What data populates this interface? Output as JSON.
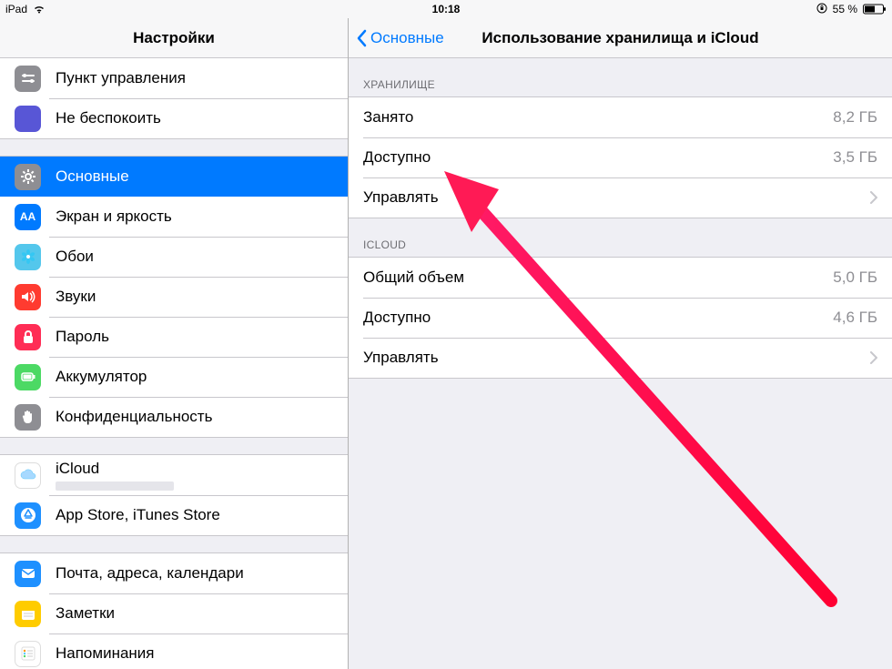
{
  "status": {
    "carrier": "iPad",
    "time": "10:18",
    "battery_pct": "55 %"
  },
  "sidebar": {
    "title": "Настройки",
    "groups": [
      {
        "rows": [
          {
            "id": "control-center",
            "label": "Пункт управления",
            "icon": "switches",
            "bg": "#8e8e93"
          },
          {
            "id": "dnd",
            "label": "Не беспокоить",
            "icon": "moon",
            "bg": "#5856d6"
          }
        ]
      },
      {
        "rows": [
          {
            "id": "general",
            "label": "Основные",
            "icon": "gear",
            "bg": "#8e8e93",
            "selected": true
          },
          {
            "id": "display",
            "label": "Экран и яркость",
            "icon": "AA",
            "bg": "#007aff",
            "text_icon": "AA"
          },
          {
            "id": "wallpaper",
            "label": "Обои",
            "icon": "flower",
            "bg": "#54c7ec"
          },
          {
            "id": "sounds",
            "label": "Звуки",
            "icon": "speaker",
            "bg": "#ff3b30"
          },
          {
            "id": "passcode",
            "label": "Пароль",
            "icon": "lock",
            "bg": "#ff2d55"
          },
          {
            "id": "battery",
            "label": "Аккумулятор",
            "icon": "battery",
            "bg": "#4cd964"
          },
          {
            "id": "privacy",
            "label": "Конфиденциальность",
            "icon": "hand",
            "bg": "#8e8e93"
          }
        ]
      },
      {
        "rows": [
          {
            "id": "icloud",
            "label": "iCloud",
            "icon": "cloud",
            "bg": "#ffffff",
            "has_sub": true
          },
          {
            "id": "stores",
            "label": "App Store, iTunes Store",
            "icon": "appstore",
            "bg": "#1e90ff"
          }
        ]
      },
      {
        "rows": [
          {
            "id": "mail",
            "label": "Почта, адреса, календари",
            "icon": "mail",
            "bg": "#1e90ff"
          },
          {
            "id": "notes",
            "label": "Заметки",
            "icon": "notes",
            "bg": "#ffcc00"
          },
          {
            "id": "reminders",
            "label": "Напоминания",
            "icon": "reminders",
            "bg": "#ffffff"
          }
        ]
      }
    ]
  },
  "detail": {
    "back_label": "Основные",
    "title": "Использование хранилища и iCloud",
    "sections": [
      {
        "header": "ХРАНИЛИЩЕ",
        "rows": [
          {
            "id": "storage-used",
            "label": "Занято",
            "value": "8,2 ГБ"
          },
          {
            "id": "storage-avail",
            "label": "Доступно",
            "value": "3,5 ГБ"
          },
          {
            "id": "storage-manage",
            "label": "Управлять",
            "chevron": true
          }
        ]
      },
      {
        "header": "ICLOUD",
        "rows": [
          {
            "id": "icloud-total",
            "label": "Общий объем",
            "value": "5,0 ГБ"
          },
          {
            "id": "icloud-avail",
            "label": "Доступно",
            "value": "4,6 ГБ"
          },
          {
            "id": "icloud-manage",
            "label": "Управлять",
            "chevron": true
          }
        ]
      }
    ]
  }
}
